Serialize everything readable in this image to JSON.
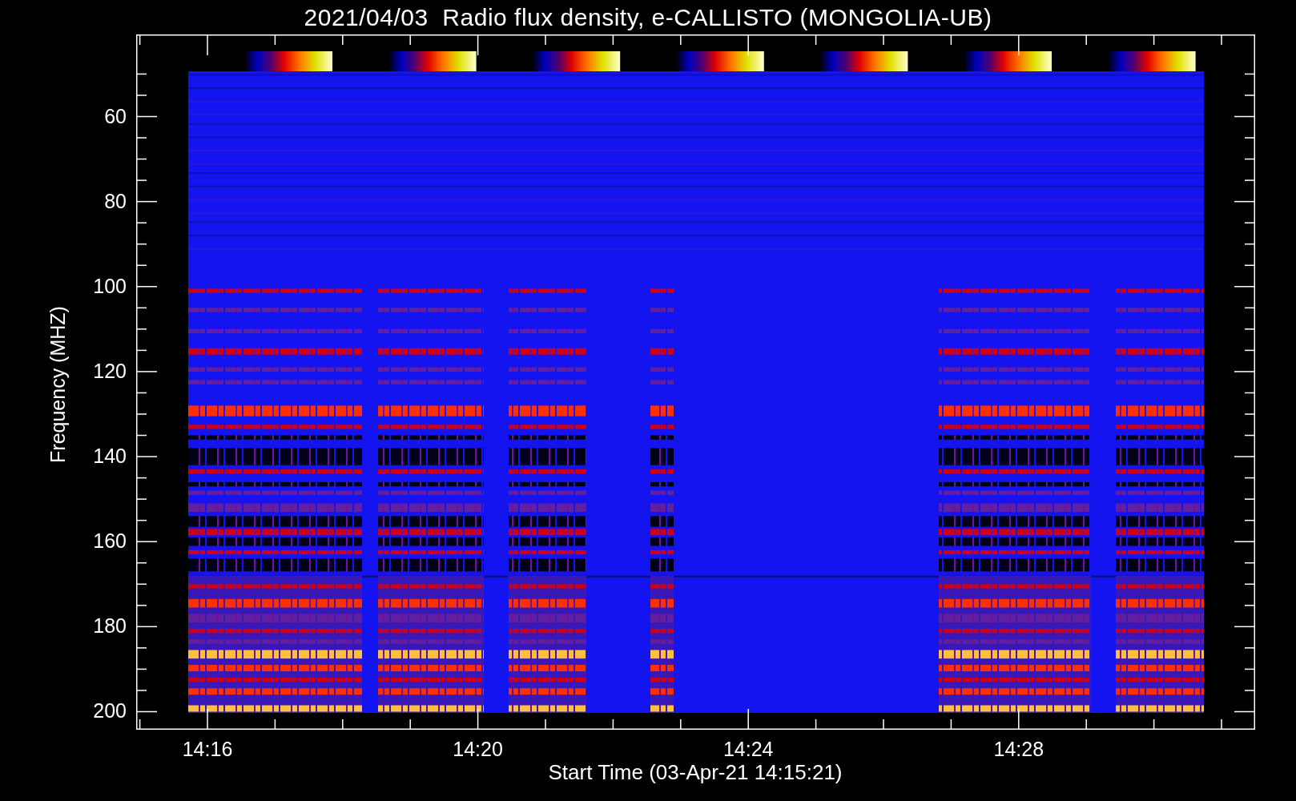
{
  "title": "2021/04/03  Radio flux density, e-CALLISTO (MONGOLIA-UB)",
  "y_axis": {
    "label": "Frequency (MHZ)",
    "ticks": [
      "60",
      "80",
      "100",
      "120",
      "140",
      "160",
      "180",
      "200"
    ]
  },
  "x_axis": {
    "label": "Start Time (03-Apr-21 14:15:21)",
    "ticks": [
      "14:16",
      "14:20",
      "14:24",
      "14:28"
    ]
  }
}
